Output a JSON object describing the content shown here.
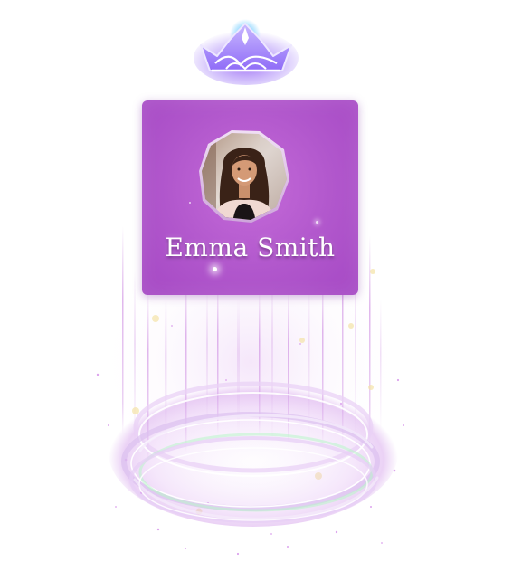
{
  "profile": {
    "name": "Emma Smith"
  },
  "icons": {
    "crown": "crown-icon",
    "avatar": "avatar"
  },
  "colors": {
    "card": "#b157cc",
    "crown": "#8b5cf6",
    "crown_glow": "#7c3aed",
    "beam": "#c77dde",
    "ring": "#d9b3f0",
    "ring_inner_glow": "#b8f5c8"
  }
}
